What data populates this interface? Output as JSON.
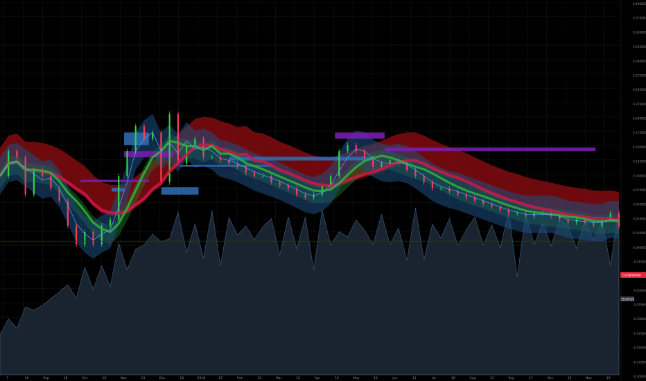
{
  "chart_data": {
    "type": "line",
    "title": "",
    "xlabel": "",
    "ylabel": "",
    "grid": true,
    "legend": "none",
    "colors": {
      "background": "#000000",
      "volume_fill": "#1c2633",
      "volume_line": "#3d5f82",
      "cloud_bear": "#8a0d12",
      "cloud_bull": "#1e7a2a",
      "band_blue": "#1e4e80",
      "ribbon_red": "#d0184a",
      "ribbon_green": "#35b03c",
      "zone_purple": "#7a1fb3",
      "zone_blue": "#2f6fb8",
      "current_price": "#e5283c",
      "zero_line": "#6b1a1a",
      "axis_text": "#8a8a8a"
    },
    "x_ticks": [
      "7",
      "18",
      "Sep",
      "18",
      "Oct",
      "16",
      "Nov",
      "13",
      "Dec",
      "18",
      "2018",
      "15",
      "Feb",
      "12",
      "Mar",
      "12",
      "Apr",
      "16",
      "May",
      "14",
      "Jun",
      "11",
      "Jul",
      "16",
      "Aug",
      "13",
      "Sep",
      "17",
      "Oct",
      "15",
      "Nov",
      "19"
    ],
    "y_ticks": [
      "0.40000000",
      "0.37500000",
      "0.35000000",
      "0.32500000",
      "0.30000000",
      "0.27500000",
      "0.25000000",
      "0.22500000",
      "0.20000000",
      "0.17500000",
      "0.15000000",
      "0.12500000",
      "0.10000000",
      "0.07500000",
      "0.05000000",
      "0.02500000",
      "0.01000000",
      "0.00000000",
      "-0.01000000",
      "-0.02500000",
      "-0.05000000",
      "-0.07500000",
      "-0.10000000",
      "-0.12500000",
      "-0.15000000",
      "-0.17500000",
      "-0.20000000"
    ],
    "price_label": "0.03850000",
    "countdown_label": "15:03:21",
    "price_series": [
      {
        "x": 0,
        "y": 0.12
      },
      {
        "x": 1,
        "y": 0.16
      },
      {
        "x": 2,
        "y": 0.15
      },
      {
        "x": 3,
        "y": 0.09
      },
      {
        "x": 4,
        "y": 0.13
      },
      {
        "x": 5,
        "y": 0.12
      },
      {
        "x": 6,
        "y": 0.1
      },
      {
        "x": 7,
        "y": 0.08
      },
      {
        "x": 8,
        "y": 0.04
      },
      {
        "x": 9,
        "y": 0.01
      },
      {
        "x": 10,
        "y": 0.03
      },
      {
        "x": 11,
        "y": 0.01
      },
      {
        "x": 12,
        "y": 0.04
      },
      {
        "x": 13,
        "y": 0.05
      },
      {
        "x": 14,
        "y": 0.12
      },
      {
        "x": 15,
        "y": 0.16
      },
      {
        "x": 16,
        "y": 0.2
      },
      {
        "x": 17,
        "y": 0.18
      },
      {
        "x": 18,
        "y": 0.19
      },
      {
        "x": 19,
        "y": 0.11
      },
      {
        "x": 20,
        "y": 0.22
      },
      {
        "x": 21,
        "y": 0.14
      },
      {
        "x": 22,
        "y": 0.17
      },
      {
        "x": 23,
        "y": 0.18
      },
      {
        "x": 24,
        "y": 0.15
      },
      {
        "x": 25,
        "y": 0.15
      },
      {
        "x": 26,
        "y": 0.145
      },
      {
        "x": 27,
        "y": 0.14
      },
      {
        "x": 28,
        "y": 0.135
      },
      {
        "x": 29,
        "y": 0.125
      },
      {
        "x": 30,
        "y": 0.12
      },
      {
        "x": 31,
        "y": 0.12
      },
      {
        "x": 32,
        "y": 0.11
      },
      {
        "x": 33,
        "y": 0.105
      },
      {
        "x": 34,
        "y": 0.1
      },
      {
        "x": 35,
        "y": 0.09
      },
      {
        "x": 36,
        "y": 0.085
      },
      {
        "x": 37,
        "y": 0.09
      },
      {
        "x": 38,
        "y": 0.105
      },
      {
        "x": 39,
        "y": 0.12
      },
      {
        "x": 40,
        "y": 0.16
      },
      {
        "x": 41,
        "y": 0.17
      },
      {
        "x": 42,
        "y": 0.16
      },
      {
        "x": 43,
        "y": 0.15
      },
      {
        "x": 44,
        "y": 0.135
      },
      {
        "x": 45,
        "y": 0.14
      },
      {
        "x": 46,
        "y": 0.145
      },
      {
        "x": 47,
        "y": 0.14
      },
      {
        "x": 48,
        "y": 0.13
      },
      {
        "x": 49,
        "y": 0.12
      },
      {
        "x": 50,
        "y": 0.11
      },
      {
        "x": 51,
        "y": 0.1
      },
      {
        "x": 52,
        "y": 0.1
      },
      {
        "x": 53,
        "y": 0.095
      },
      {
        "x": 54,
        "y": 0.09
      },
      {
        "x": 55,
        "y": 0.085
      },
      {
        "x": 56,
        "y": 0.08
      },
      {
        "x": 57,
        "y": 0.075
      },
      {
        "x": 58,
        "y": 0.07
      },
      {
        "x": 59,
        "y": 0.065
      },
      {
        "x": 60,
        "y": 0.06
      },
      {
        "x": 61,
        "y": 0.06
      },
      {
        "x": 62,
        "y": 0.055
      },
      {
        "x": 63,
        "y": 0.06
      },
      {
        "x": 64,
        "y": 0.06
      },
      {
        "x": 65,
        "y": 0.055
      },
      {
        "x": 66,
        "y": 0.05
      },
      {
        "x": 67,
        "y": 0.045
      },
      {
        "x": 68,
        "y": 0.05
      },
      {
        "x": 69,
        "y": 0.045
      },
      {
        "x": 70,
        "y": 0.04
      },
      {
        "x": 71,
        "y": 0.05
      },
      {
        "x": 72,
        "y": 0.06
      },
      {
        "x": 73,
        "y": 0.038
      }
    ]
  }
}
